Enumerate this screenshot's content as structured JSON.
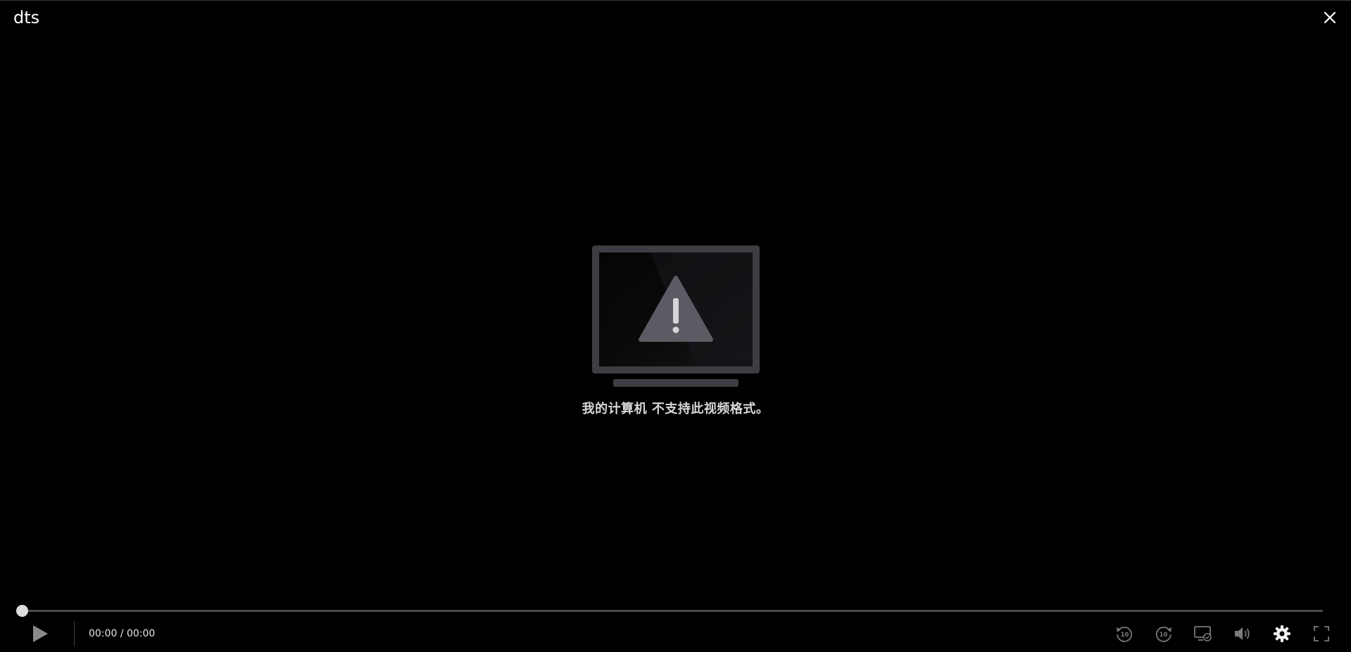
{
  "window": {
    "title": "dts"
  },
  "message": {
    "error_text": "我的计算机 不支持此视频格式。",
    "icon": "warning-monitor-icon"
  },
  "playback": {
    "time_display": "00:00 / 00:00",
    "progress": 0
  },
  "controls": {
    "play": "play-icon",
    "rewind": "rewind-10-icon",
    "forward": "forward-10-icon",
    "cast": "cast-icon",
    "volume": "volume-icon",
    "settings": "gear-icon",
    "fullscreen": "fullscreen-icon",
    "close": "close-icon"
  },
  "colors": {
    "background": "#000000",
    "icon_gray": "#6e6e74",
    "text": "#d8d8d8"
  }
}
